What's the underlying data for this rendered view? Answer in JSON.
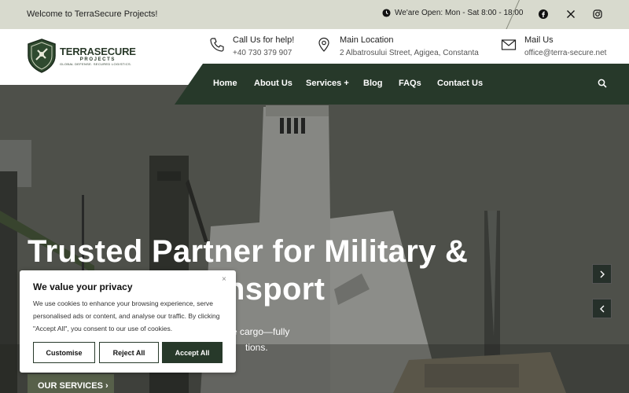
{
  "topbar": {
    "welcome": "Welcome to TerraSecure Projects!",
    "hours": "We'are Open: Mon - Sat 8:00 - 18:00",
    "social": [
      "facebook-icon",
      "x-icon",
      "instagram-icon"
    ]
  },
  "logo": {
    "name": "TERRASECURE",
    "sub": "PROJECTS",
    "tagline": "GLOBAL DEFENSE. SECURED LOGISTICS."
  },
  "contacts": [
    {
      "label": "Call Us for help!",
      "value": "+40 730 379 907",
      "icon": "phone-icon"
    },
    {
      "label": "Main Location",
      "value": "2 Albatrosului Street, Agigea, Constanta",
      "icon": "location-pin-icon"
    },
    {
      "label": "Mail Us",
      "value": "office@terra-secure.net",
      "icon": "mail-icon"
    }
  ],
  "nav": {
    "items": [
      "Home",
      "About Us",
      "Services +",
      "Blog",
      "FAQs",
      "Contact Us"
    ]
  },
  "hero": {
    "title_line1": "Trusted Partner for Military &",
    "title_line2": "nsport",
    "body_line1": "e cargo—fully",
    "body_line2": "tions.",
    "button": "OUR SERVICES ›"
  },
  "cookie": {
    "title": "We value your privacy",
    "close": "×",
    "text": "We use cookies to enhance your browsing experience, serve personalised ads or content, and analyse our traffic. By clicking \"Accept All\", you consent to our use of cookies.",
    "customise": "Customise",
    "reject": "Reject All",
    "accept": "Accept All"
  },
  "colors": {
    "nav_bg": "#27392a",
    "topbar_bg": "#d8dace",
    "button_bg": "#57604a"
  }
}
